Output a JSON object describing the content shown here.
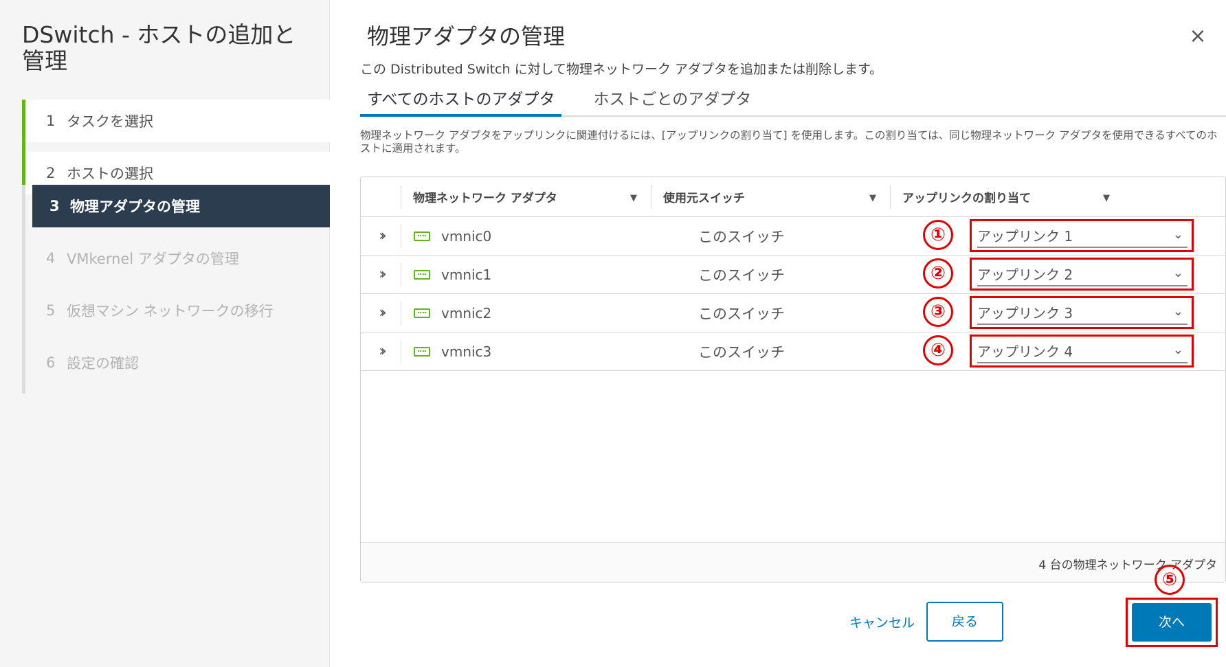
{
  "sidebar": {
    "title": "DSwitch - ホストの追加と管理",
    "steps": [
      {
        "num": "1",
        "label": "タスクを選択"
      },
      {
        "num": "2",
        "label": "ホストの選択"
      },
      {
        "num": "3",
        "label": "物理アダプタの管理"
      },
      {
        "num": "4",
        "label": "VMkernel アダプタの管理"
      },
      {
        "num": "5",
        "label": "仮想マシン ネットワークの移行"
      },
      {
        "num": "6",
        "label": "設定の確認"
      }
    ]
  },
  "main": {
    "title": "物理アダプタの管理",
    "close_icon": "×",
    "subtitle": "この Distributed Switch に対して物理ネットワーク アダプタを追加または削除します。",
    "tabs": [
      "すべてのホストのアダプタ",
      "ホストごとのアダプタ"
    ],
    "description": "物理ネットワーク アダプタをアップリンクに関連付けるには、[アップリンクの割り当て] を使用します。この割り当ては、同じ物理ネットワーク アダプタを使用できるすべてのホストに適用されます。",
    "grid": {
      "columns": [
        "物理ネットワーク アダプタ",
        "使用元スイッチ",
        "アップリンクの割り当て"
      ],
      "rows": [
        {
          "adapter": "vmnic0",
          "switch": "このスイッチ",
          "uplink": "アップリンク 1",
          "marker": "①"
        },
        {
          "adapter": "vmnic1",
          "switch": "このスイッチ",
          "uplink": "アップリンク 2",
          "marker": "②"
        },
        {
          "adapter": "vmnic2",
          "switch": "このスイッチ",
          "uplink": "アップリンク 3",
          "marker": "③"
        },
        {
          "adapter": "vmnic3",
          "switch": "このスイッチ",
          "uplink": "アップリンク 4",
          "marker": "④"
        }
      ],
      "footer": "4 台の物理ネットワーク アダプタ"
    },
    "buttons": {
      "cancel": "キャンセル",
      "back": "戻る",
      "next": "次へ"
    },
    "next_marker": "⑤"
  },
  "colors": {
    "accent": "#0079b8",
    "active_step": "#2b3d4f",
    "complete_bar": "#61b715",
    "annotation": "#e00000"
  },
  "icons": {
    "expander": "double-chevron-right-icon",
    "nic": "network-adapter-icon",
    "filter": "filter-icon",
    "dropdown": "chevron-down-icon"
  }
}
